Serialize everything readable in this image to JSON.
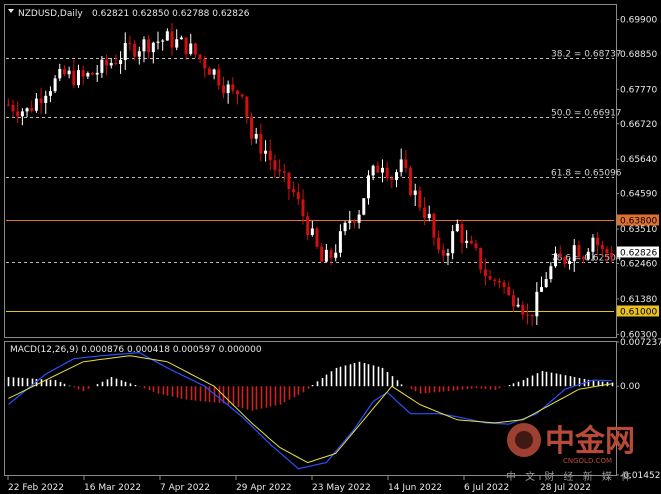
{
  "header": {
    "symbol": "NZDUSD,Daily",
    "ohlc": "0.62821 0.62850 0.62788 0.62826"
  },
  "macd_header": "MACD(12,26,9) 0.000876 0.000418 0.000597 0.000000",
  "watermark": {
    "brand": "中金网",
    "domain": "CNGOLD.COM",
    "tagline": "中 文 财 经 新 媒 体"
  },
  "colors": {
    "background": "#000000",
    "candle_up": "#ffffff",
    "candle_down": "#d01010",
    "fib_line": "#bdbdbd",
    "level_high": "#e07030",
    "level_low": "#e8c020",
    "macd_hist_pos": "#ffffff",
    "macd_hist_neg": "#d02020",
    "macd_main": "#2a50ff",
    "macd_signal": "#e8e040",
    "current_price_box": "#ffffff"
  },
  "chart_data": [
    {
      "type": "candlestick",
      "title": "NZDUSD,Daily",
      "ylim": [
        0.6022,
        0.7034
      ],
      "x_tick_labels": [
        "22 Feb 2022",
        "16 Mar 2022",
        "7 Apr 2022",
        "29 Apr 2022",
        "23 May 2022",
        "14 Jun 2022",
        "6 Jul 2022",
        "28 Jul 2022"
      ],
      "y_tick_labels": [
        "0.69900",
        "0.68850",
        "0.67770",
        "0.66720",
        "0.65640",
        "0.64590",
        "0.63510",
        "0.62460",
        "0.61380",
        "0.60300"
      ],
      "fib_levels": [
        {
          "label": "38.2 = 0.68737",
          "value": 0.68737
        },
        {
          "label": "50.0 = 0.66917",
          "value": 0.66917
        },
        {
          "label": "61.8 = 0.65096",
          "value": 0.65096
        },
        {
          "label": "78.6 = 0.62504",
          "value": 0.62504
        }
      ],
      "horizontal_levels": [
        {
          "label": "0.63800",
          "value": 0.638
        },
        {
          "label": "0.61000",
          "value": 0.61
        }
      ],
      "current_price": "0.62826",
      "path_keypoints": [
        {
          "i": 0,
          "c": 0.673
        },
        {
          "i": 4,
          "c": 0.671
        },
        {
          "i": 8,
          "c": 0.678
        },
        {
          "i": 12,
          "c": 0.682
        },
        {
          "i": 16,
          "c": 0.681
        },
        {
          "i": 20,
          "c": 0.684
        },
        {
          "i": 26,
          "c": 0.69
        },
        {
          "i": 30,
          "c": 0.692
        },
        {
          "i": 34,
          "c": 0.693
        },
        {
          "i": 38,
          "c": 0.691
        },
        {
          "i": 41,
          "c": 0.687
        },
        {
          "i": 44,
          "c": 0.683
        },
        {
          "i": 48,
          "c": 0.676
        },
        {
          "i": 50,
          "c": 0.678
        },
        {
          "i": 52,
          "c": 0.663
        },
        {
          "i": 55,
          "c": 0.659
        },
        {
          "i": 58,
          "c": 0.651
        },
        {
          "i": 61,
          "c": 0.646
        },
        {
          "i": 64,
          "c": 0.636
        },
        {
          "i": 67,
          "c": 0.625
        },
        {
          "i": 69,
          "c": 0.627
        },
        {
          "i": 71,
          "c": 0.632
        },
        {
          "i": 73,
          "c": 0.638
        },
        {
          "i": 75,
          "c": 0.641
        },
        {
          "i": 77,
          "c": 0.65
        },
        {
          "i": 80,
          "c": 0.656
        },
        {
          "i": 82,
          "c": 0.651
        },
        {
          "i": 84,
          "c": 0.654
        },
        {
          "i": 86,
          "c": 0.648
        },
        {
          "i": 88,
          "c": 0.643
        },
        {
          "i": 90,
          "c": 0.638
        },
        {
          "i": 92,
          "c": 0.626
        },
        {
          "i": 94,
          "c": 0.63
        },
        {
          "i": 96,
          "c": 0.636
        },
        {
          "i": 98,
          "c": 0.63
        },
        {
          "i": 100,
          "c": 0.627
        },
        {
          "i": 103,
          "c": 0.619
        },
        {
          "i": 105,
          "c": 0.62
        },
        {
          "i": 107,
          "c": 0.614
        },
        {
          "i": 109,
          "c": 0.615
        },
        {
          "i": 111,
          "c": 0.608
        },
        {
          "i": 113,
          "c": 0.613
        },
        {
          "i": 115,
          "c": 0.621
        },
        {
          "i": 117,
          "c": 0.625
        },
        {
          "i": 119,
          "c": 0.626
        },
        {
          "i": 121,
          "c": 0.63
        },
        {
          "i": 123,
          "c": 0.628
        },
        {
          "i": 125,
          "c": 0.633
        },
        {
          "i": 127,
          "c": 0.628
        },
        {
          "i": 129,
          "c": 0.628
        }
      ]
    },
    {
      "type": "macd",
      "title": "MACD(12,26,9) 0.000876 0.000418 0.000597 0.000000",
      "ylim": [
        -0.014529,
        0.007237
      ],
      "y_tick_labels": [
        "0.007237",
        "0.00",
        "-0.014529"
      ],
      "hist_keypoints": [
        {
          "i": 0,
          "v": 0.0015
        },
        {
          "i": 10,
          "v": 0.001
        },
        {
          "i": 16,
          "v": -0.0008
        },
        {
          "i": 22,
          "v": 0.0015
        },
        {
          "i": 27,
          "v": 0.0002
        },
        {
          "i": 32,
          "v": -0.0012
        },
        {
          "i": 38,
          "v": -0.0022
        },
        {
          "i": 46,
          "v": -0.0028
        },
        {
          "i": 52,
          "v": -0.004
        },
        {
          "i": 58,
          "v": -0.003
        },
        {
          "i": 63,
          "v": -0.001
        },
        {
          "i": 66,
          "v": 0.0008
        },
        {
          "i": 70,
          "v": 0.003
        },
        {
          "i": 75,
          "v": 0.004
        },
        {
          "i": 80,
          "v": 0.003
        },
        {
          "i": 84,
          "v": 0.0003
        },
        {
          "i": 88,
          "v": -0.0012
        },
        {
          "i": 94,
          "v": -0.0008
        },
        {
          "i": 100,
          "v": -0.0003
        },
        {
          "i": 104,
          "v": -0.0006
        },
        {
          "i": 110,
          "v": 0.001
        },
        {
          "i": 114,
          "v": 0.0025
        },
        {
          "i": 119,
          "v": 0.0018
        },
        {
          "i": 125,
          "v": 0.0009
        },
        {
          "i": 129,
          "v": 0.0006
        }
      ],
      "main_keypoints": [
        {
          "i": 0,
          "v": -0.003
        },
        {
          "i": 8,
          "v": 0.002
        },
        {
          "i": 14,
          "v": 0.0045
        },
        {
          "i": 20,
          "v": 0.005
        },
        {
          "i": 28,
          "v": 0.0055
        },
        {
          "i": 34,
          "v": 0.003
        },
        {
          "i": 42,
          "v": 0.0
        },
        {
          "i": 50,
          "v": -0.005
        },
        {
          "i": 56,
          "v": -0.0095
        },
        {
          "i": 62,
          "v": -0.0135
        },
        {
          "i": 68,
          "v": -0.0125
        },
        {
          "i": 74,
          "v": -0.007
        },
        {
          "i": 78,
          "v": -0.0025
        },
        {
          "i": 81,
          "v": -0.001
        },
        {
          "i": 86,
          "v": -0.0045
        },
        {
          "i": 92,
          "v": -0.0045
        },
        {
          "i": 96,
          "v": -0.005
        },
        {
          "i": 102,
          "v": -0.006
        },
        {
          "i": 107,
          "v": -0.0062
        },
        {
          "i": 113,
          "v": -0.0045
        },
        {
          "i": 119,
          "v": -0.0005
        },
        {
          "i": 125,
          "v": 0.001
        },
        {
          "i": 129,
          "v": 0.0009
        }
      ],
      "signal_keypoints": [
        {
          "i": 0,
          "v": -0.002
        },
        {
          "i": 8,
          "v": 0.001
        },
        {
          "i": 16,
          "v": 0.004
        },
        {
          "i": 26,
          "v": 0.005
        },
        {
          "i": 34,
          "v": 0.004
        },
        {
          "i": 44,
          "v": 0.0
        },
        {
          "i": 52,
          "v": -0.006
        },
        {
          "i": 58,
          "v": -0.01
        },
        {
          "i": 64,
          "v": -0.0125
        },
        {
          "i": 70,
          "v": -0.011
        },
        {
          "i": 76,
          "v": -0.0055
        },
        {
          "i": 82,
          "v": 0.0
        },
        {
          "i": 88,
          "v": -0.003
        },
        {
          "i": 96,
          "v": -0.0055
        },
        {
          "i": 104,
          "v": -0.006
        },
        {
          "i": 110,
          "v": -0.0055
        },
        {
          "i": 116,
          "v": -0.003
        },
        {
          "i": 122,
          "v": -0.0005
        },
        {
          "i": 129,
          "v": 0.0004
        }
      ]
    }
  ]
}
